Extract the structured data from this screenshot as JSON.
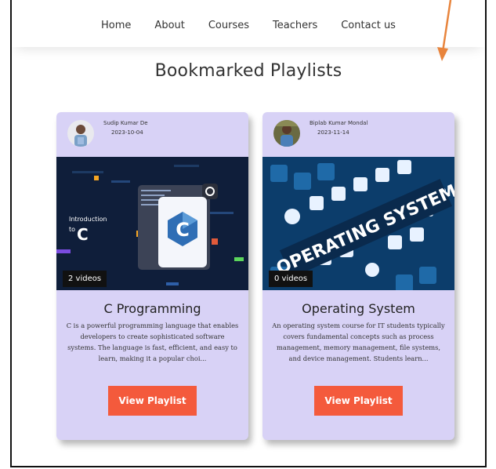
{
  "nav": {
    "items": [
      {
        "label": "Home"
      },
      {
        "label": "About"
      },
      {
        "label": "Courses"
      },
      {
        "label": "Teachers"
      },
      {
        "label": "Contact us"
      }
    ]
  },
  "page_title": "Bookmarked Playlists",
  "playlists": [
    {
      "author": "Sudip Kumar De",
      "date": "2023-10-04",
      "thumbnail_text": "Introduction to C",
      "videos": "2 videos",
      "title": "C Programming",
      "description": "C is a powerful programming language that enables developers to create sophisticated software systems. The language is fast, efficient, and easy to learn, making it a popular choi...",
      "button": "View Playlist"
    },
    {
      "author": "Biplab Kumar Mondal",
      "date": "2023-11-14",
      "thumbnail_text": "OPERATING SYSTEM",
      "videos": "0 videos",
      "title": "Operating System",
      "description": "An operating system course for IT students typically covers fundamental concepts such as process management, memory management, file systems, and device management. Students learn...",
      "button": "View Playlist"
    }
  ],
  "colors": {
    "card_bg": "#d8d2f6",
    "button": "#f45a3c",
    "annotation_arrow": "#e8843c"
  }
}
